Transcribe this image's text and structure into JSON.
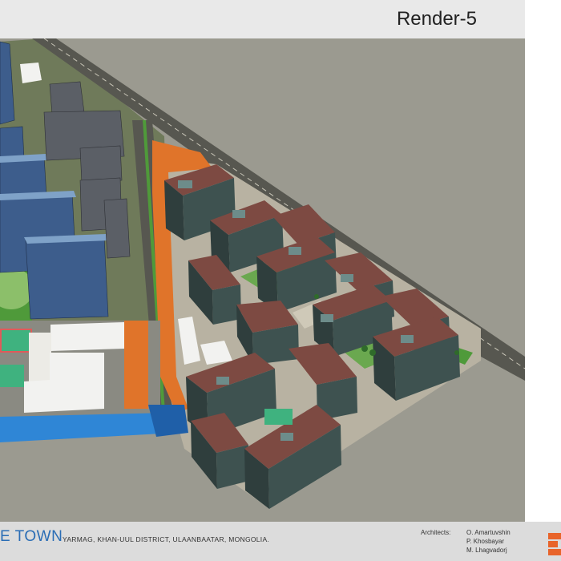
{
  "header": {
    "title": "Render-5"
  },
  "footer": {
    "project_title": "E TOWN",
    "location": "YARMAG, KHAN-UUL DISTRICT, ULAANBAATAR, MONGOLIA.",
    "architects_label": "Architects:",
    "architects": [
      "O. Amartuvshin",
      "P. Khosbayar",
      "M. Lhagvadorj"
    ]
  },
  "colors": {
    "ground": "#9b9a90",
    "road": "#575750",
    "roof": "#7d4a42",
    "facade": "#3e5250",
    "plaza": "#b8b2a2",
    "accent_orange": "#e0742a",
    "green": "#4f9a3a",
    "water": "#2f86d6",
    "brand_blue": "#2a6db5"
  },
  "icons": {
    "logo": "firm-logo-icon"
  }
}
